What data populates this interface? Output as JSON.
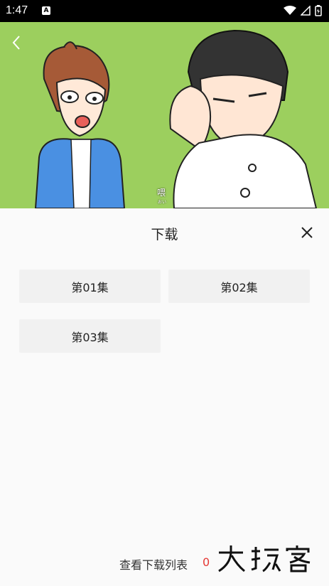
{
  "status_bar": {
    "time": "1:47",
    "notif_letter": "A"
  },
  "hero": {
    "caption": "喂",
    "caption_small": "おい"
  },
  "sheet": {
    "title": "下载",
    "episodes": [
      "第01集",
      "第02集",
      "第03集"
    ],
    "footer_label": "查看下载列表",
    "download_count": "0",
    "watermark": "大玩客"
  }
}
